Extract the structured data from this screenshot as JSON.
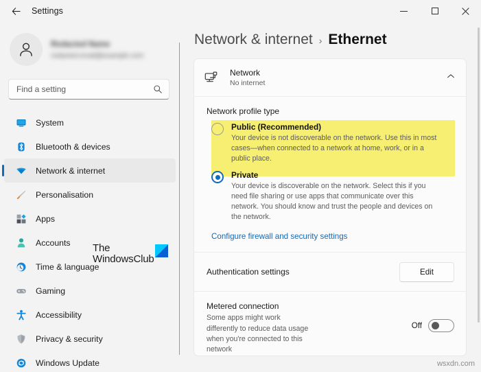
{
  "titlebar": {
    "back_icon": "back-arrow-icon",
    "app_title": "Settings",
    "minimize_label": "Minimize",
    "maximize_label": "Maximize",
    "close_label": "Close"
  },
  "account": {
    "avatar_icon": "person-avatar-icon",
    "name_redacted": "Redacted Name",
    "email_redacted": "redacted.email@example.com"
  },
  "search": {
    "placeholder": "Find a setting",
    "value": "",
    "icon": "search-icon"
  },
  "sidebar": {
    "items": [
      {
        "label": "System",
        "icon": "monitor-icon",
        "active": false
      },
      {
        "label": "Bluetooth & devices",
        "icon": "bluetooth-icon",
        "active": false
      },
      {
        "label": "Network & internet",
        "icon": "wifi-icon",
        "active": true
      },
      {
        "label": "Personalisation",
        "icon": "paintbrush-icon",
        "active": false
      },
      {
        "label": "Apps",
        "icon": "apps-grid-icon",
        "active": false
      },
      {
        "label": "Accounts",
        "icon": "person-icon",
        "active": false
      },
      {
        "label": "Time & language",
        "icon": "clock-globe-icon",
        "active": false
      },
      {
        "label": "Gaming",
        "icon": "gamepad-icon",
        "active": false
      },
      {
        "label": "Accessibility",
        "icon": "accessibility-person-icon",
        "active": false
      },
      {
        "label": "Privacy & security",
        "icon": "shield-icon",
        "active": false
      },
      {
        "label": "Windows Update",
        "icon": "refresh-circle-icon",
        "active": false
      }
    ]
  },
  "breadcrumb": {
    "parent": "Network & internet",
    "separator": "›",
    "current": "Ethernet"
  },
  "network_card": {
    "icon": "ethernet-monitor-icon",
    "title": "Network",
    "subtitle": "No internet",
    "expander_icon": "chevron-up-icon"
  },
  "profile_section": {
    "label": "Network profile type",
    "highlight_color": "#f7ef71",
    "options": [
      {
        "title": "Public (Recommended)",
        "description": "Your device is not discoverable on the network. Use this in most cases—when connected to a network at home, work, or in a public place.",
        "selected": false,
        "highlighted": true
      },
      {
        "title": "Private",
        "description": "Your device is discoverable on the network. Select this if you need file sharing or use apps that communicate over this network. You should know and trust the people and devices on the network.",
        "selected": true,
        "highlighted": false
      }
    ],
    "link": "Configure firewall and security settings"
  },
  "authentication": {
    "label": "Authentication settings",
    "button": "Edit"
  },
  "metered": {
    "title": "Metered connection",
    "description": "Some apps might work differently to reduce data usage when you're connected to this network",
    "state": "Off",
    "toggle_on": false
  },
  "watermarks": {
    "brand_line1": "The",
    "brand_line2": "WindowsClub",
    "site": "wsxdn.com"
  },
  "colors": {
    "accent": "#0f6cbd",
    "link": "#1767b0",
    "highlight": "#f7ef71",
    "window_bg": "#f3f3f3",
    "card_bg": "#fbfbfb"
  }
}
